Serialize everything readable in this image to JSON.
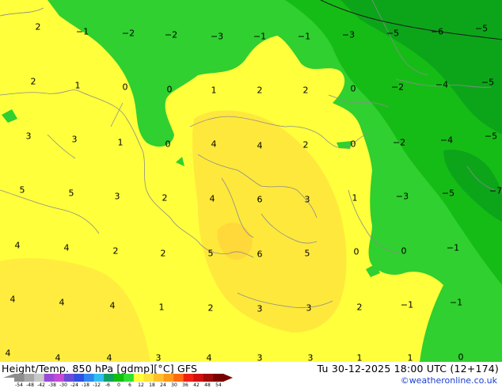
{
  "map": {
    "colors": {
      "yellow": "#ffff3c",
      "orange_warm": "#ffe23a",
      "orange_core": "#ffcc30",
      "green_light": "#2fd02f",
      "green_mid": "#12b812",
      "green_dark": "#0a9e1e",
      "coast": "#8c8c8c",
      "contour": "#1a1a1a"
    },
    "values": [
      {
        "t": "2"
      },
      {
        "t": "-1"
      },
      {
        "t": "-2"
      },
      {
        "t": "-2"
      },
      {
        "t": "-3"
      },
      {
        "t": "-1"
      },
      {
        "t": "-1"
      },
      {
        "t": "-3"
      },
      {
        "t": "-5"
      },
      {
        "t": "-6"
      },
      {
        "t": "-5"
      },
      {
        "t": "2"
      },
      {
        "t": "1"
      },
      {
        "t": "0"
      },
      {
        "t": "0"
      },
      {
        "t": "1"
      },
      {
        "t": "2"
      },
      {
        "t": "2"
      },
      {
        "t": "0"
      },
      {
        "t": "-2"
      },
      {
        "t": "-4"
      },
      {
        "t": "-5"
      },
      {
        "t": "3"
      },
      {
        "t": "3"
      },
      {
        "t": "1"
      },
      {
        "t": "0"
      },
      {
        "t": "4"
      },
      {
        "t": "4"
      },
      {
        "t": "2"
      },
      {
        "t": "0"
      },
      {
        "t": "-2"
      },
      {
        "t": "-4"
      },
      {
        "t": "-5"
      },
      {
        "t": "5"
      },
      {
        "t": "5"
      },
      {
        "t": "3"
      },
      {
        "t": "2"
      },
      {
        "t": "4"
      },
      {
        "t": "6"
      },
      {
        "t": "3"
      },
      {
        "t": "1"
      },
      {
        "t": "-3"
      },
      {
        "t": "-5"
      },
      {
        "t": "-7"
      },
      {
        "t": "4"
      },
      {
        "t": "4"
      },
      {
        "t": "2"
      },
      {
        "t": "2"
      },
      {
        "t": "5"
      },
      {
        "t": "6"
      },
      {
        "t": "5"
      },
      {
        "t": "0"
      },
      {
        "t": "0"
      },
      {
        "t": "-1"
      },
      {
        "t": "4"
      },
      {
        "t": "4"
      },
      {
        "t": "4"
      },
      {
        "t": "1"
      },
      {
        "t": "2"
      },
      {
        "t": "3"
      },
      {
        "t": "3"
      },
      {
        "t": "2"
      },
      {
        "t": "-1"
      },
      {
        "t": "-1"
      },
      {
        "t": "4"
      },
      {
        "t": "4"
      },
      {
        "t": "4"
      },
      {
        "t": "3"
      },
      {
        "t": "4"
      },
      {
        "t": "3"
      },
      {
        "t": "3"
      },
      {
        "t": "1"
      },
      {
        "t": "1"
      },
      {
        "t": "0"
      }
    ]
  },
  "footer": {
    "left_title": "Height/Temp. 850 hPa [gdmp][°C] GFS",
    "right_title": "Tu 30-12-2025 18:00 UTC (12+174)",
    "credit": "©weatheronline.co.uk",
    "scale_ticks": [
      "-54",
      "-48",
      "-42",
      "-38",
      "-30",
      "-24",
      "-18",
      "-12",
      "-6",
      "0",
      "6",
      "12",
      "18",
      "24",
      "30",
      "36",
      "42",
      "48",
      "54"
    ],
    "scale_colors": [
      "#8c8c8c",
      "#a8a8a8",
      "#c8c8c8",
      "#9a4ad6",
      "#c34bd6",
      "#6a4bd6",
      "#3050e0",
      "#2e86f0",
      "#30c0f0",
      "#10a060",
      "#10c010",
      "#30e030",
      "#ffff3c",
      "#ffe23a",
      "#ffc02a",
      "#ff9a1a",
      "#ff6a10",
      "#f02010",
      "#d01010",
      "#a00a0a",
      "#7a0000"
    ]
  }
}
